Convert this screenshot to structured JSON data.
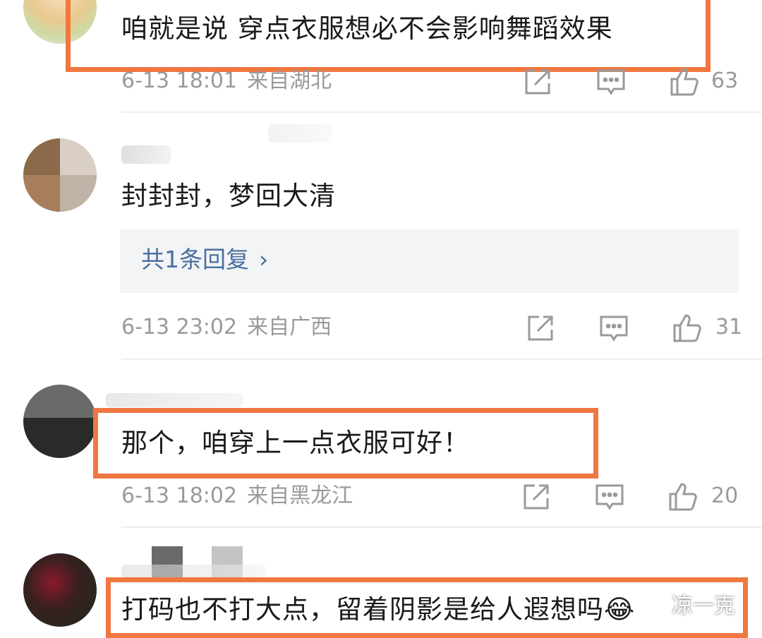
{
  "comments": [
    {
      "text": "咱就是说 穿点衣服想必不会影响舞蹈效果",
      "time": "6-13 18:01",
      "location": "来自湖北",
      "likes": "63"
    },
    {
      "text": "封封封，梦回大清",
      "reply_label": "共1条回复",
      "reply_chevron": "›",
      "time": "6-13 23:02",
      "location": "来自广西",
      "likes": "31"
    },
    {
      "text": "那个，咱穿上一点衣服可好！",
      "time": "6-13 18:02",
      "location": "来自黑龙江",
      "likes": "20"
    },
    {
      "text": "打码也不打大点，留着阴影是给人遐想吗😂",
      "watermark": "凉一克"
    }
  ],
  "colors": {
    "highlight": "#f0773f",
    "meta": "#9a9a9a",
    "reply_link": "#4a6f9e"
  },
  "icons": [
    "share-icon",
    "comment-icon",
    "like-icon"
  ]
}
